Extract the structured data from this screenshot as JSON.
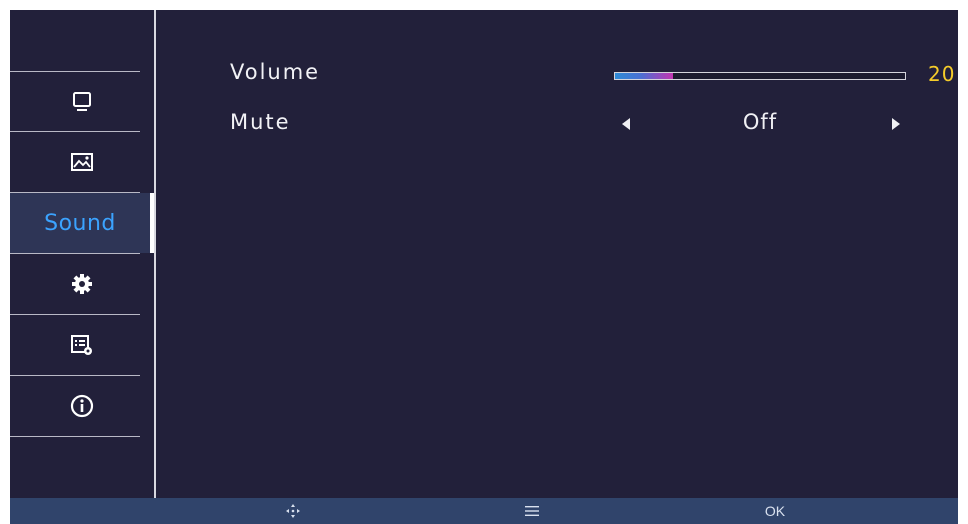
{
  "sidebar": {
    "items": [
      {
        "name": "monitor-icon",
        "label": ""
      },
      {
        "name": "picture-icon",
        "label": ""
      },
      {
        "name": "sound",
        "label": "Sound"
      },
      {
        "name": "gear-icon",
        "label": ""
      },
      {
        "name": "system-settings-icon",
        "label": ""
      },
      {
        "name": "info-icon",
        "label": ""
      }
    ],
    "active_index": 2
  },
  "main": {
    "volume": {
      "label": "Volume",
      "value": "20",
      "level": 0.2
    },
    "mute": {
      "label": "Mute",
      "value": "Off"
    }
  },
  "bottom_bar": {
    "move_icon": "move-arrows-icon",
    "menu_icon": "menu-icon",
    "ok_label": "OK"
  },
  "colors": {
    "background": "#22203a",
    "accent": "#3ba3ff",
    "value_highlight": "#f5cc2a",
    "bottom_bar": "#30446b"
  }
}
